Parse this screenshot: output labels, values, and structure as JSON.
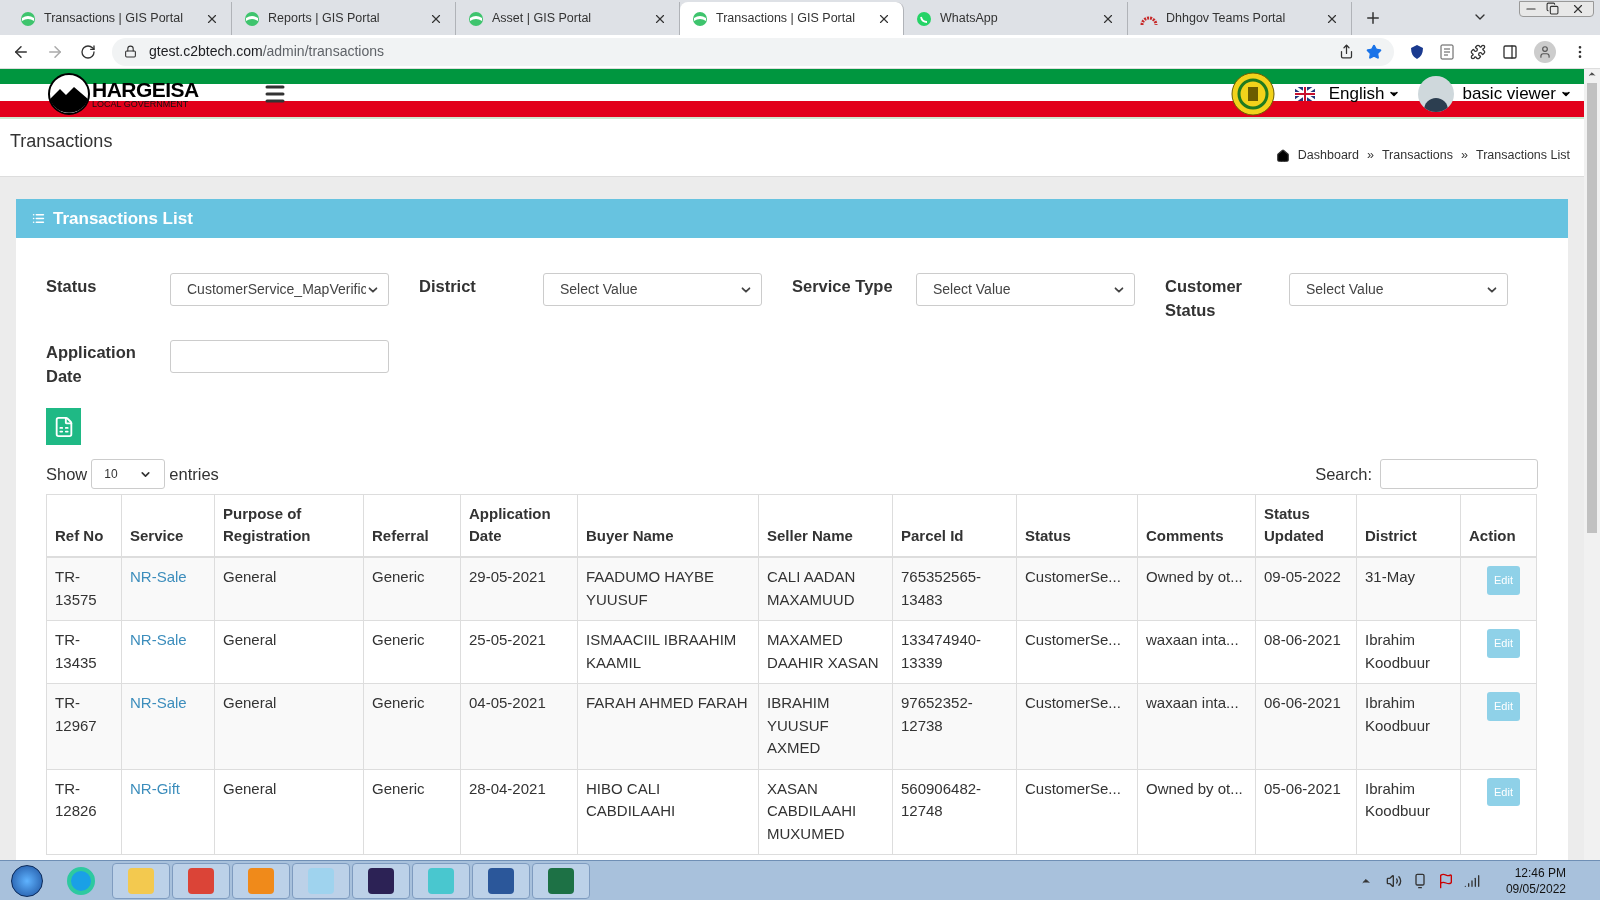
{
  "browser": {
    "tabs": [
      {
        "title": "Transactions | GIS Portal",
        "kind": "gis",
        "selected": false
      },
      {
        "title": "Reports | GIS Portal",
        "kind": "gis",
        "selected": false
      },
      {
        "title": "Asset | GIS Portal",
        "kind": "gis",
        "selected": false
      },
      {
        "title": "Transactions | GIS Portal",
        "kind": "gis",
        "selected": true
      },
      {
        "title": "WhatsApp",
        "kind": "whatsapp",
        "selected": false
      },
      {
        "title": "Dhhgov Teams Portal",
        "kind": "teams",
        "selected": false
      }
    ],
    "url_host": "gtest.c2btech.com",
    "url_path": "/admin/transactions"
  },
  "header": {
    "brand": "HARGEISA",
    "brand_sub": "LOCAL GOVERNMENT",
    "language": "English",
    "user": "basic viewer"
  },
  "page": {
    "title": "Transactions",
    "breadcrumb": [
      "Dashboard",
      "Transactions",
      "Transactions List"
    ],
    "separator": "»"
  },
  "card": {
    "title": "Transactions List",
    "filters": [
      {
        "label": "Status",
        "kind": "select",
        "value": "CustomerService_MapVerific"
      },
      {
        "label": "District",
        "kind": "select",
        "value": "Select Value"
      },
      {
        "label": "Service Type",
        "kind": "select",
        "value": "Select Value"
      },
      {
        "label": "Customer Status",
        "kind": "select",
        "value": "Select Value"
      },
      {
        "label": "Application Date",
        "kind": "input"
      }
    ],
    "show_label": "Show",
    "entries_value": "10",
    "entries_label": "entries",
    "search_label": "Search:",
    "table": {
      "columns": [
        "Ref No",
        "Service",
        "Purpose of Registration",
        "Referral",
        "Application Date",
        "Buyer Name",
        "Seller Name",
        "Parcel Id",
        "Status",
        "Comments",
        "Status Updated",
        "District",
        "Action"
      ],
      "rows": [
        {
          "ref": "TR-13575",
          "service": "NR-Sale",
          "purpose": "General",
          "referral": "Generic",
          "date": "29-05-2021",
          "buyer": "FAADUMO HAYBE YUUSUF",
          "seller": "CALI AADAN MAXAMUUD",
          "parcel": "765352565-13483",
          "status": "CustomerSe...",
          "comments": "Owned by ot...",
          "updated": "09-05-2022",
          "district": "31-May",
          "action": "Edit"
        },
        {
          "ref": "TR-13435",
          "service": "NR-Sale",
          "purpose": "General",
          "referral": "Generic",
          "date": "25-05-2021",
          "buyer": "ISMAACIIL IBRAAHIM KAAMIL",
          "seller": "MAXAMED DAAHIR XASAN",
          "parcel": "133474940-13339",
          "status": "CustomerSe...",
          "comments": "waxaan inta...",
          "updated": "08-06-2021",
          "district": "Ibrahim Koodbuur",
          "action": "Edit"
        },
        {
          "ref": "TR-12967",
          "service": "NR-Sale",
          "purpose": "General",
          "referral": "Generic",
          "date": "04-05-2021",
          "buyer": "FARAH AHMED FARAH",
          "seller": "IBRAHIM YUUSUF AXMED",
          "parcel": "97652352-12738",
          "status": "CustomerSe...",
          "comments": "waxaan inta...",
          "updated": "06-06-2021",
          "district": "Ibrahim Koodbuur",
          "action": "Edit"
        },
        {
          "ref": "TR-12826",
          "service": "NR-Gift",
          "purpose": "General",
          "referral": "Generic",
          "date": "28-04-2021",
          "buyer": "HIBO CALI CABDILAAHI",
          "seller": "XASAN CABDILAAHI MUXUMED",
          "parcel": "560906482-12748",
          "status": "CustomerSe...",
          "comments": "Owned by ot...",
          "updated": "05-06-2021",
          "district": "Ibrahim Koodbuur",
          "action": "Edit"
        }
      ]
    }
  },
  "taskbar": {
    "time": "12:46 PM",
    "date": "09/05/2022"
  }
}
